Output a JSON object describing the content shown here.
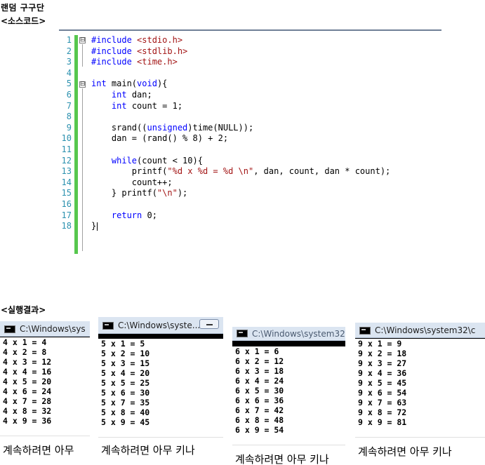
{
  "doc": {
    "title": "랜덤 구구단",
    "source_heading": "<소스코드>",
    "result_heading": "<실행결과>"
  },
  "editor": {
    "line_numbers": [
      "1",
      "2",
      "3",
      "4",
      "5",
      "6",
      "7",
      "8",
      "9",
      "10",
      "11",
      "12",
      "13",
      "14",
      "15",
      "16",
      "17",
      "18"
    ],
    "fold_markers": [
      "⊟",
      "⊟"
    ]
  },
  "code_lines": [
    [
      {
        "t": "#include ",
        "c": "pp"
      },
      {
        "t": "<stdio.h>",
        "c": "inc"
      }
    ],
    [
      {
        "t": "#include ",
        "c": "pp"
      },
      {
        "t": "<stdlib.h>",
        "c": "inc"
      }
    ],
    [
      {
        "t": "#include ",
        "c": "pp"
      },
      {
        "t": "<time.h>",
        "c": "inc"
      }
    ],
    [],
    [
      {
        "t": "int",
        "c": "kw"
      },
      {
        "t": " main(",
        "c": ""
      },
      {
        "t": "void",
        "c": "kw"
      },
      {
        "t": "){",
        "c": ""
      }
    ],
    [
      {
        "t": "    ",
        "c": ""
      },
      {
        "t": "int",
        "c": "kw"
      },
      {
        "t": " dan;",
        "c": ""
      }
    ],
    [
      {
        "t": "    ",
        "c": ""
      },
      {
        "t": "int",
        "c": "kw"
      },
      {
        "t": " count = 1;",
        "c": ""
      }
    ],
    [],
    [
      {
        "t": "    srand((",
        "c": ""
      },
      {
        "t": "unsigned",
        "c": "kw"
      },
      {
        "t": ")time(NULL));",
        "c": ""
      }
    ],
    [
      {
        "t": "    dan = (rand() % 8) + 2;",
        "c": ""
      }
    ],
    [],
    [
      {
        "t": "    ",
        "c": ""
      },
      {
        "t": "while",
        "c": "kw"
      },
      {
        "t": "(count < 10){",
        "c": ""
      }
    ],
    [
      {
        "t": "        printf(",
        "c": ""
      },
      {
        "t": "\"%d x %d = %d \\n\"",
        "c": "str"
      },
      {
        "t": ", dan, count, dan * count);",
        "c": ""
      }
    ],
    [
      {
        "t": "        count++;",
        "c": ""
      }
    ],
    [
      {
        "t": "    } printf(",
        "c": ""
      },
      {
        "t": "\"\\n\"",
        "c": "str"
      },
      {
        "t": ");",
        "c": ""
      }
    ],
    [],
    [
      {
        "t": "    ",
        "c": ""
      },
      {
        "t": "return",
        "c": "kw"
      },
      {
        "t": " 0;",
        "c": ""
      }
    ],
    [
      {
        "t": "}",
        "c": ""
      }
    ]
  ],
  "consoles": [
    {
      "title": "C:\\Windows\\sys",
      "lines": [
        "4 x 1 = 4",
        "4 x 2 = 8",
        "4 x 3 = 12",
        "4 x 4 = 16",
        "4 x 5 = 20",
        "4 x 6 = 24",
        "4 x 7 = 28",
        "4 x 8 = 32",
        "4 x 9 = 36"
      ],
      "footer": "계속하려면 아무"
    },
    {
      "title": "C:\\Windows\\syste...",
      "lines": [
        "5 x 1 = 5",
        "5 x 2 = 10",
        "5 x 3 = 15",
        "5 x 4 = 20",
        "5 x 5 = 25",
        "5 x 6 = 30",
        "5 x 7 = 35",
        "5 x 8 = 40",
        "5 x 9 = 45"
      ],
      "footer": "계속하려면 아무 키나"
    },
    {
      "title": "C:\\Windows\\system32\\",
      "lines": [
        "6 x 1 = 6",
        "6 x 2 = 12",
        "6 x 3 = 18",
        "6 x 4 = 24",
        "6 x 5 = 30",
        "6 x 6 = 36",
        "6 x 7 = 42",
        "6 x 8 = 48",
        "6 x 9 = 54"
      ],
      "footer": "계속하려면 아무 키나"
    },
    {
      "title": "C:\\Windows\\system32\\c",
      "lines": [
        "9 x 1 = 9",
        "9 x 2 = 18",
        "9 x 3 = 27",
        "9 x 4 = 36",
        "9 x 5 = 45",
        "9 x 6 = 54",
        "9 x 7 = 63",
        "9 x 8 = 72",
        "9 x 9 = 81"
      ],
      "footer": "계속하려면 아무 키나"
    }
  ]
}
